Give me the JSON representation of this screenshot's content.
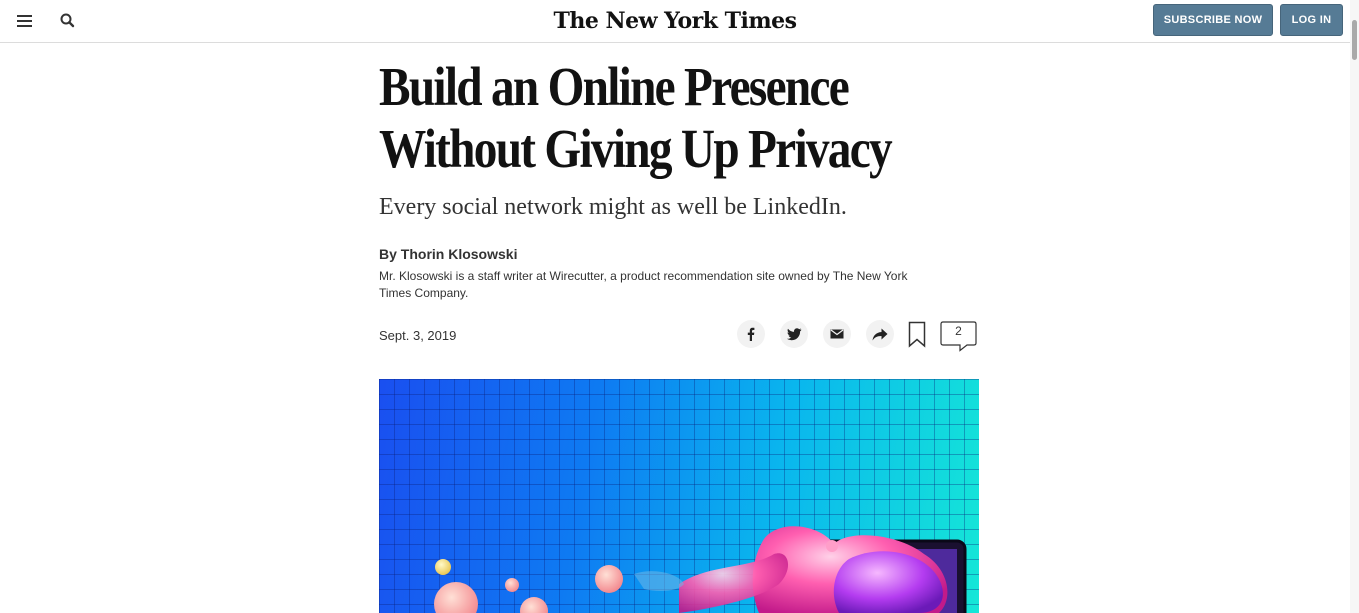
{
  "header": {
    "masthead": "The New York Times",
    "subscribe_label": "SUBSCRIBE NOW",
    "login_label": "LOG IN",
    "menu_icon": "hamburger-menu-icon",
    "search_icon": "search-icon"
  },
  "article": {
    "headline_line1": "Build an Online Presence",
    "headline_line2": "Without Giving Up Privacy",
    "summary": "Every social network might as well be LinkedIn.",
    "byline": "By Thorin Klosowski",
    "bio": "Mr. Klosowski is a staff writer at Wirecutter, a product recommendation site owned by The New York Times Company.",
    "date": "Sept. 3, 2019",
    "comment_count": "2"
  },
  "share_tools": [
    "facebook-icon",
    "twitter-icon",
    "email-icon",
    "share-arrow-icon",
    "bookmark-icon",
    "comments-icon"
  ],
  "colors": {
    "button_bg": "#567b95",
    "text": "#121212",
    "hero_gradient_start": "#1a4ff0",
    "hero_gradient_end": "#15e7d7"
  }
}
